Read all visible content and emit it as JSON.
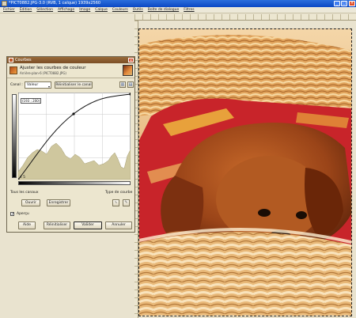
{
  "window": {
    "title": "*PICT0882.JPG-3.0 (RVB, 1 calque) 1939x2560"
  },
  "menubar": {
    "items": [
      "Fichier",
      "Édition",
      "Sélection",
      "Affichage",
      "Image",
      "Calque",
      "Couleurs",
      "Outils",
      "Boîte de dialogue",
      "Filtres"
    ]
  },
  "dialog": {
    "title": "Courbes",
    "heading": "Ajuster les courbes de couleur",
    "subheading": "Arrière-plan-6 (PICT0882.JPG)",
    "canal_label": "Canal :",
    "canal_value": "Valeur",
    "reset_channel_label": "Réinitialiser le canal",
    "coordinate": "(193 ; 200)",
    "corner_value": "x 5",
    "all_channels_label": "Tous les canaux",
    "curve_type_label": "Type de courbe",
    "open_label": "Ouvrir",
    "save_label": "Enregistrer",
    "preview_label": "Aperçu",
    "help_label": "Aide",
    "reset_label": "Réinitialiser",
    "ok_label": "Valider",
    "cancel_label": "Annuler"
  },
  "colors": {
    "titlebar": "#0b48c4",
    "dialog_bg": "#ece6cf",
    "histogram": "#cfc79e"
  }
}
